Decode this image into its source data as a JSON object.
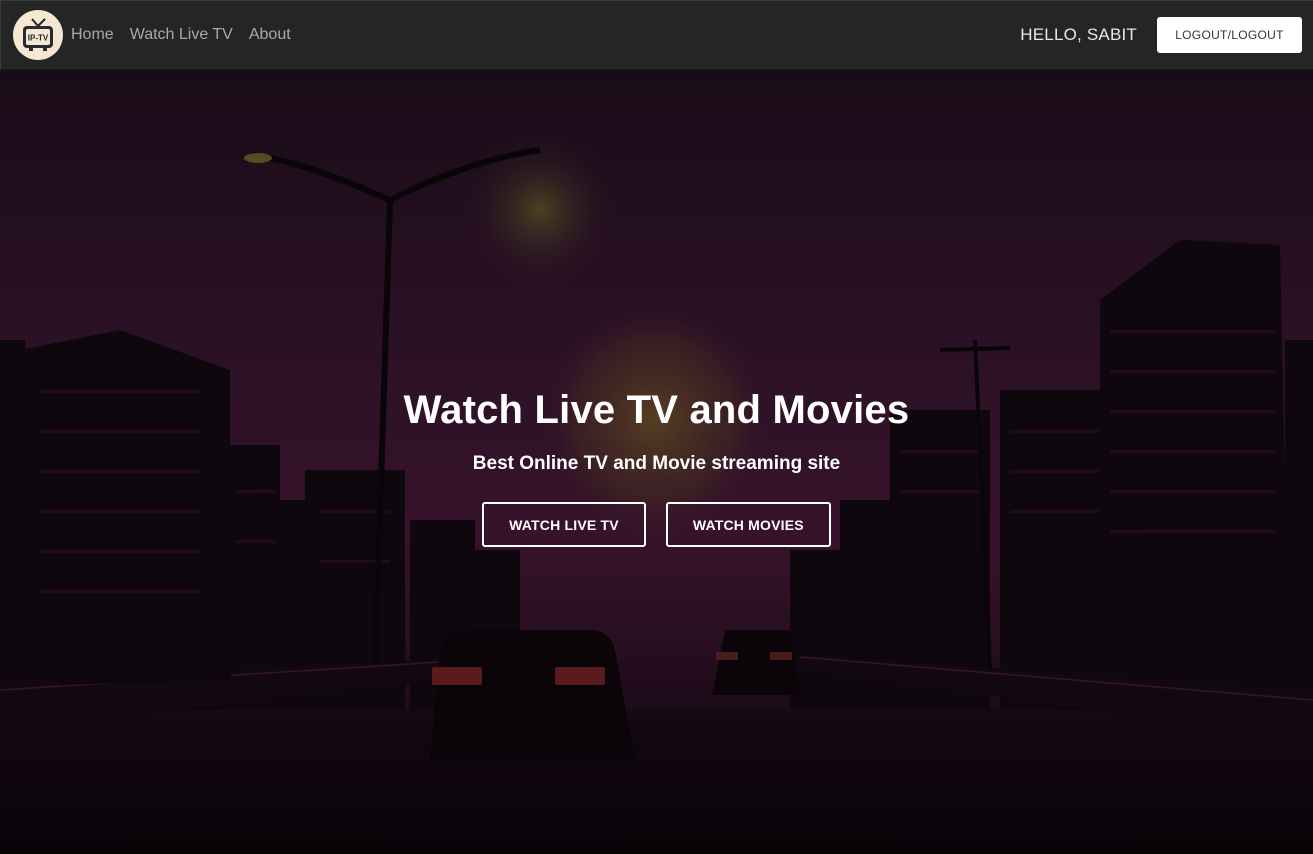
{
  "nav": {
    "logo_text": "IP-TV",
    "links": [
      {
        "label": "Home"
      },
      {
        "label": "Watch Live TV"
      },
      {
        "label": "About"
      }
    ],
    "greeting": "HELLO, SABIT",
    "logout_label": "LOGOUT/LOGOUT"
  },
  "hero": {
    "title": "Watch Live TV and Movies",
    "subtitle": "Best Online TV and Movie streaming site",
    "buttons": [
      {
        "label": "WATCH LIVE TV"
      },
      {
        "label": "WATCH MOVIES"
      }
    ]
  },
  "colors": {
    "navbar_bg": "#252525",
    "nav_link": "#a9a9a9",
    "hero_sky": "#3a1733",
    "button_outline": "#ffffff"
  }
}
